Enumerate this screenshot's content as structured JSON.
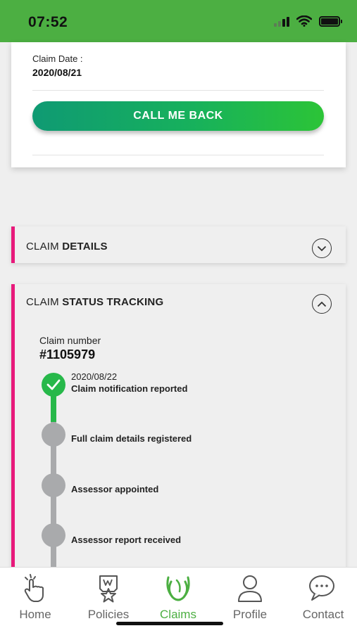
{
  "status_bar": {
    "time": "07:52"
  },
  "claim_card": {
    "claim_date_label": "Claim Date :",
    "claim_date_value": "2020/08/21",
    "call_button_label": "CALL ME BACK"
  },
  "claim_details_panel": {
    "title_prefix": "CLAIM",
    "title_bold": "DETAILS",
    "expanded": false
  },
  "tracking_panel": {
    "title_prefix": "CLAIM",
    "title_bold": "STATUS TRACKING",
    "expanded": true,
    "claim_number_label": "Claim number",
    "claim_number_value": "#1105979",
    "steps": [
      {
        "date": "2020/08/22",
        "label": "Claim notification reported",
        "status": "complete"
      },
      {
        "date": "",
        "label": "Full claim details registered",
        "status": "pending"
      },
      {
        "date": "",
        "label": "Assessor appointed",
        "status": "pending"
      },
      {
        "date": "",
        "label": "Assessor report received",
        "status": "pending"
      }
    ]
  },
  "tab_bar": {
    "active": "Claims",
    "tabs": [
      {
        "label": "Home",
        "icon": "hand-tap-icon"
      },
      {
        "label": "Policies",
        "icon": "policy-badge-icon"
      },
      {
        "label": "Claims",
        "icon": "claims-swirl-icon"
      },
      {
        "label": "Profile",
        "icon": "person-icon"
      },
      {
        "label": "Contact",
        "icon": "chat-bubbles-icon"
      }
    ]
  },
  "colors": {
    "header_green": "#4caf42",
    "accent_pink": "#e8197b",
    "step_complete": "#27b84a",
    "step_pending": "#a9aaac",
    "active_tab": "#4caf42"
  }
}
